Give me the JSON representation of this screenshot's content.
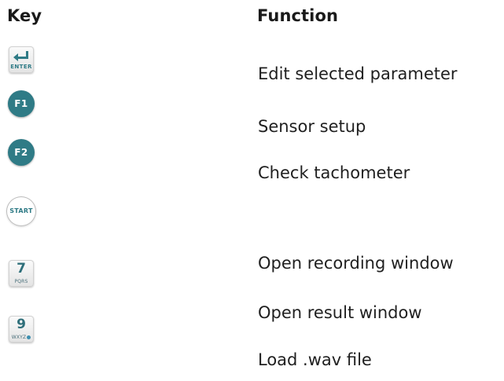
{
  "headers": {
    "key": "Key",
    "function": "Function"
  },
  "rows": [
    {
      "key_icon": "enter-key-icon",
      "key_label": "ENTER",
      "function": "Edit selected parameter"
    },
    {
      "key_icon": "f1-key-icon",
      "key_label": "F1",
      "function": "Sensor setup"
    },
    {
      "key_icon": "f2-key-icon",
      "key_label": "F2",
      "function": "Check tachometer"
    },
    {
      "key_icon": "start-key-icon",
      "key_label": "START",
      "function": "Open recording window"
    },
    {
      "key_icon": "key-7-icon",
      "key_label": "7",
      "key_sublabel": "PQRS",
      "function": "Open result window"
    },
    {
      "key_icon": "key-9-icon",
      "key_label": "9",
      "key_sublabel": "WXYZ",
      "function": "Load .wav file"
    }
  ],
  "colors": {
    "key_teal": "#2f7b86",
    "text": "#1f1f1f"
  }
}
